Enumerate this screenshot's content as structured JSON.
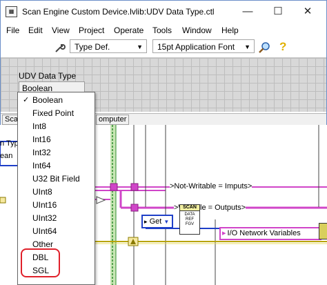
{
  "window": {
    "title": "Scan Engine Custom Device.lvlib:UDV Data Type.ctl",
    "controls": {
      "minimize": "—",
      "maximize": "☐",
      "close": "✕"
    }
  },
  "menu": [
    "File",
    "Edit",
    "View",
    "Project",
    "Operate",
    "Tools",
    "Window",
    "Help"
  ],
  "toolbar": {
    "control_type": "Type Def.",
    "font": "15pt Application Font",
    "wrench_icon": "wrench-icon",
    "search_icon": "search-icon",
    "help_icon": "help-icon"
  },
  "panel": {
    "control_label": "UDV Data Type",
    "control_value": "Boolean"
  },
  "statusbar": {
    "left": "Sca",
    "right": "omputer"
  },
  "dropdown": {
    "selected_index": 0,
    "check_mark": "✓",
    "items": [
      "Boolean",
      "Fixed Point",
      "Int8",
      "Int16",
      "Int32",
      "Int64",
      "U32 Bit Field",
      "UInt8",
      "UInt16",
      "UInt32",
      "UInt64",
      "Other",
      "DBL",
      "SGL"
    ]
  },
  "diagram": {
    "left_label_1": "n Typ",
    "left_label_2": "ean",
    "not_writable": ">Not-Writable = Imputs>",
    "writable": ">Writable = Outputs>",
    "get_label": "Get",
    "scan_icon_text": "SCAN",
    "data_ref_icon": "SCAN DATA REF FGV",
    "io_network": "I/O Network Variables",
    "colors": {
      "pink_wire": "#d044c8",
      "green_wire": "#2e8b2e",
      "yellow_wire": "#b8a400",
      "blue_wire": "#1e3fc8",
      "highlight": "#e0202a"
    }
  }
}
